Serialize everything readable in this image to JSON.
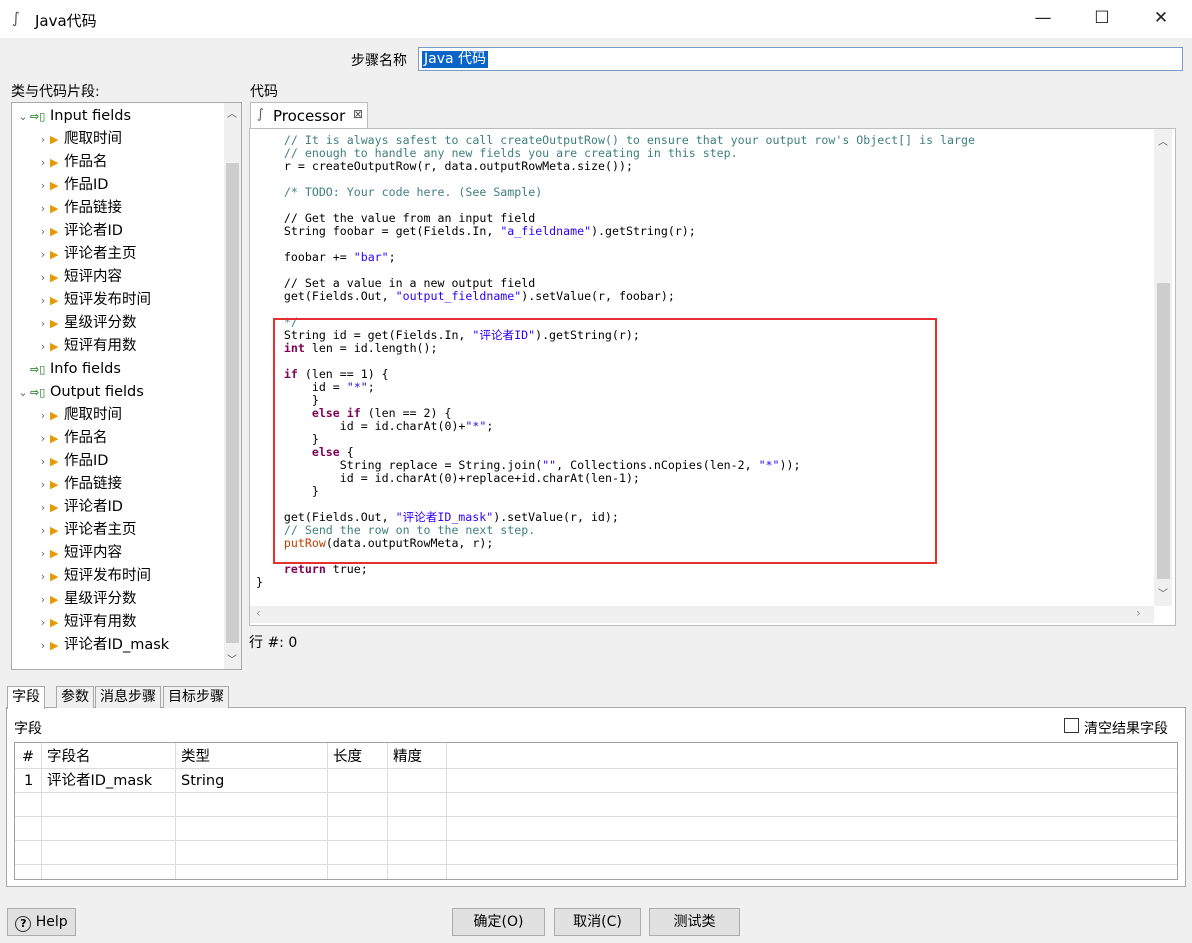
{
  "window": {
    "title": "Java代码",
    "minimize_glyph": "—",
    "maximize_glyph": "☐",
    "close_glyph": "✕"
  },
  "step": {
    "label": "步骤名称",
    "value": "Java 代码"
  },
  "tree": {
    "title": "类与代码片段:",
    "input_group": "Input fields",
    "input_items": [
      "爬取时间",
      "作品名",
      "作品ID",
      "作品链接",
      "评论者ID",
      "评论者主页",
      "短评内容",
      "短评发布时间",
      "星级评分数",
      "短评有用数"
    ],
    "info_group": "Info fields",
    "output_group": "Output fields",
    "output_items": [
      "爬取时间",
      "作品名",
      "作品ID",
      "作品链接",
      "评论者ID",
      "评论者主页",
      "短评内容",
      "短评发布时间",
      "星级评分数",
      "短评有用数",
      "评论者ID_mask"
    ]
  },
  "code": {
    "label": "代码",
    "tab": "Processor",
    "lines": [
      "    // It is always safest to call createOutputRow() to ensure that your output row's Object[] is large",
      "    // enough to handle any new fields you are creating in this step.",
      "    r = createOutputRow(r, data.outputRowMeta.size());",
      "",
      "    /* TODO: Your code here. (See Sample)",
      "",
      "    // Get the value from an input field",
      "    String foobar = get(Fields.In, \"a_fieldname\").getString(r);",
      "",
      "    foobar += \"bar\";",
      "",
      "    // Set a value in a new output field",
      "    get(Fields.Out, \"output_fieldname\").setValue(r, foobar);",
      "",
      "    */",
      "    String id = get(Fields.In, \"评论者ID\").getString(r);",
      "    int len = id.length();",
      "",
      "    if (len == 1) {",
      "        id = \"*\";",
      "        }",
      "        else if (len == 2) {",
      "            id = id.charAt(0)+\"*\";",
      "        }",
      "        else {",
      "            String replace = String.join(\"\", Collections.nCopies(len-2, \"*\"));",
      "            id = id.charAt(0)+replace+id.charAt(len-1);",
      "        }",
      "",
      "    get(Fields.Out, \"评论者ID_mask\").setValue(r, id);",
      "    // Send the row on to the next step.",
      "    putRow(data.outputRowMeta, r);",
      "",
      "    return true;",
      "}"
    ],
    "row_indicator": "行 #: 0"
  },
  "bottom_tabs": [
    "字段",
    "参数",
    "消息步骤",
    "目标步骤"
  ],
  "fields": {
    "label": "字段",
    "clear_label": "清空结果字段",
    "columns": [
      "#",
      "字段名",
      "类型",
      "长度",
      "精度"
    ],
    "rows": [
      [
        "1",
        "评论者ID_mask",
        "String",
        "",
        ""
      ]
    ]
  },
  "buttons": {
    "help": "Help",
    "ok": "确定(O)",
    "cancel": "取消(C)",
    "test": "测试类"
  },
  "colors": {
    "highlight_border": "#e53030",
    "selection": "#0a64c8",
    "comment": "#3f7f7f",
    "keyword": "#7f0055",
    "string": "#2a00ff"
  }
}
